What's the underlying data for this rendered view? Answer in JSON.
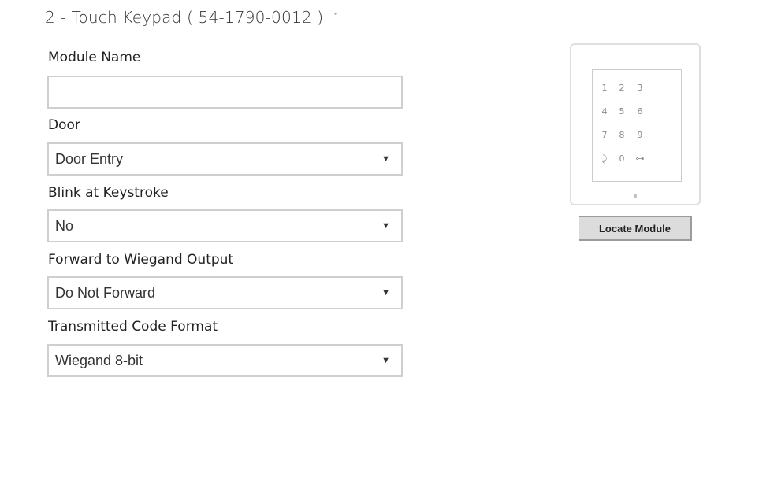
{
  "section": {
    "title": "2 - Touch Keypad ( 54-1790-0012 )",
    "chevron_icon": "chevron-down-icon",
    "chevron_glyph": "ˇ"
  },
  "fields": {
    "module_name": {
      "label": "Module Name",
      "value": "",
      "placeholder": ""
    },
    "door": {
      "label": "Door",
      "value": "Door Entry"
    },
    "blink": {
      "label": "Blink at Keystroke",
      "value": "No"
    },
    "wiegand_forward": {
      "label": "Forward to Wiegand Output",
      "value": "Do Not Forward"
    },
    "code_format": {
      "label": "Transmitted Code Format",
      "value": "Wiegand 8-bit"
    }
  },
  "dropdown_arrow": "▼",
  "device": {
    "keys": [
      "1",
      "2",
      "3",
      "4",
      "5",
      "6",
      "7",
      "8",
      "9",
      "⤸",
      "0",
      "⊶"
    ],
    "locate_button": "Locate Module"
  }
}
